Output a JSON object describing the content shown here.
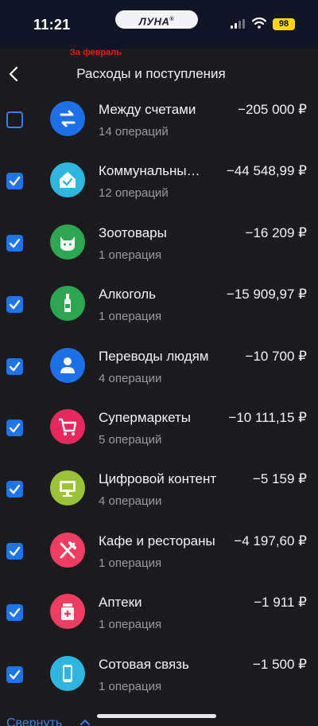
{
  "status_bar": {
    "time": "11:21",
    "carrier_logo": "ЛУНА",
    "battery": "98"
  },
  "header": {
    "period_link": "За февраль",
    "title": "Расходы и поступления"
  },
  "items": [
    {
      "checked": false,
      "icon": "arrows-swap-icon",
      "color": "#1f6fe8",
      "name": "Между счетами",
      "count": "14 операций",
      "amount": "−205 000 ₽"
    },
    {
      "checked": true,
      "icon": "home-check-icon",
      "color": "#2fb6e0",
      "name": "Коммунальны…",
      "count": "12 операций",
      "amount": "−44 548,99 ₽"
    },
    {
      "checked": true,
      "icon": "cat-icon",
      "color": "#2ea552",
      "name": "Зоотовары",
      "count": "1 операция",
      "amount": "−16 209 ₽"
    },
    {
      "checked": true,
      "icon": "bottle-icon",
      "color": "#2ea552",
      "name": "Алкоголь",
      "count": "1 операция",
      "amount": "−15 909,97 ₽"
    },
    {
      "checked": true,
      "icon": "person-icon",
      "color": "#1f6fe8",
      "name": "Переводы людям",
      "count": "4 операции",
      "amount": "−10 700 ₽"
    },
    {
      "checked": true,
      "icon": "cart-icon",
      "color": "#e5295f",
      "name": "Супермаркеты",
      "count": "5 операций",
      "amount": "−10 111,15 ₽"
    },
    {
      "checked": true,
      "icon": "monitor-icon",
      "color": "#9ac33a",
      "name": "Цифровой контент",
      "count": "4 операции",
      "amount": "−5 159 ₽"
    },
    {
      "checked": true,
      "icon": "fork-knife-icon",
      "color": "#ee3e5f",
      "name": "Кафе и рестораны",
      "count": "1 операция",
      "amount": "−4 197,60 ₽"
    },
    {
      "checked": true,
      "icon": "medicine-icon",
      "color": "#ee3e5f",
      "name": "Аптеки",
      "count": "1 операция",
      "amount": "−1 911 ₽"
    },
    {
      "checked": true,
      "icon": "phone-icon",
      "color": "#2fb6e0",
      "name": "Сотовая связь",
      "count": "1 операция",
      "amount": "−1 500 ₽"
    }
  ],
  "footer": {
    "collapse_label": "Свернуть"
  }
}
